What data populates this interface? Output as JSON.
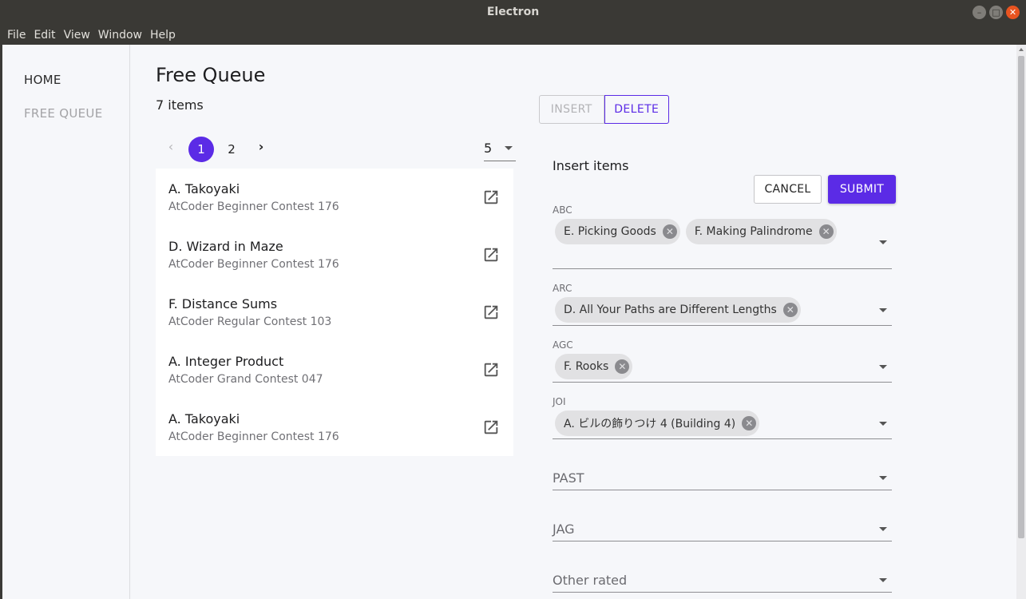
{
  "window": {
    "title": "Electron"
  },
  "menu": [
    "File",
    "Edit",
    "View",
    "Window",
    "Help"
  ],
  "sidebar": {
    "home": "HOME",
    "free_queue": "FREE QUEUE"
  },
  "main": {
    "title": "Free Queue",
    "count": "7 items",
    "pagination": {
      "prev": "‹",
      "pages": [
        "1",
        "2"
      ],
      "active_page": "1",
      "next": "›",
      "per_page": "5"
    },
    "items": [
      {
        "title": "A. Takoyaki",
        "contest": "AtCoder Beginner Contest 176"
      },
      {
        "title": "D. Wizard in Maze",
        "contest": "AtCoder Beginner Contest 176"
      },
      {
        "title": "F. Distance Sums",
        "contest": "AtCoder Regular Contest 103"
      },
      {
        "title": "A. Integer Product",
        "contest": "AtCoder Grand Contest 047"
      },
      {
        "title": "A. Takoyaki",
        "contest": "AtCoder Beginner Contest 176"
      }
    ]
  },
  "panel": {
    "mode_insert": "INSERT",
    "mode_delete": "DELETE",
    "title": "Insert items",
    "cancel": "CANCEL",
    "submit": "SUBMIT",
    "fields": {
      "abc": {
        "label": "ABC",
        "chips": [
          "E. Picking Goods",
          "F. Making Palindrome"
        ]
      },
      "arc": {
        "label": "ARC",
        "chips": [
          "D. All Your Paths are Different Lengths"
        ]
      },
      "agc": {
        "label": "AGC",
        "chips": [
          "F. Rooks"
        ]
      },
      "joi": {
        "label": "JOI",
        "chips": [
          "A. ビルの飾りつけ 4 (Building 4)"
        ]
      },
      "past": {
        "placeholder": "PAST"
      },
      "jag": {
        "placeholder": "JAG"
      },
      "other": {
        "placeholder": "Other rated"
      }
    }
  },
  "colors": {
    "accent": "#5b2be6",
    "chrome": "#3a3935",
    "close": "#e95420"
  }
}
